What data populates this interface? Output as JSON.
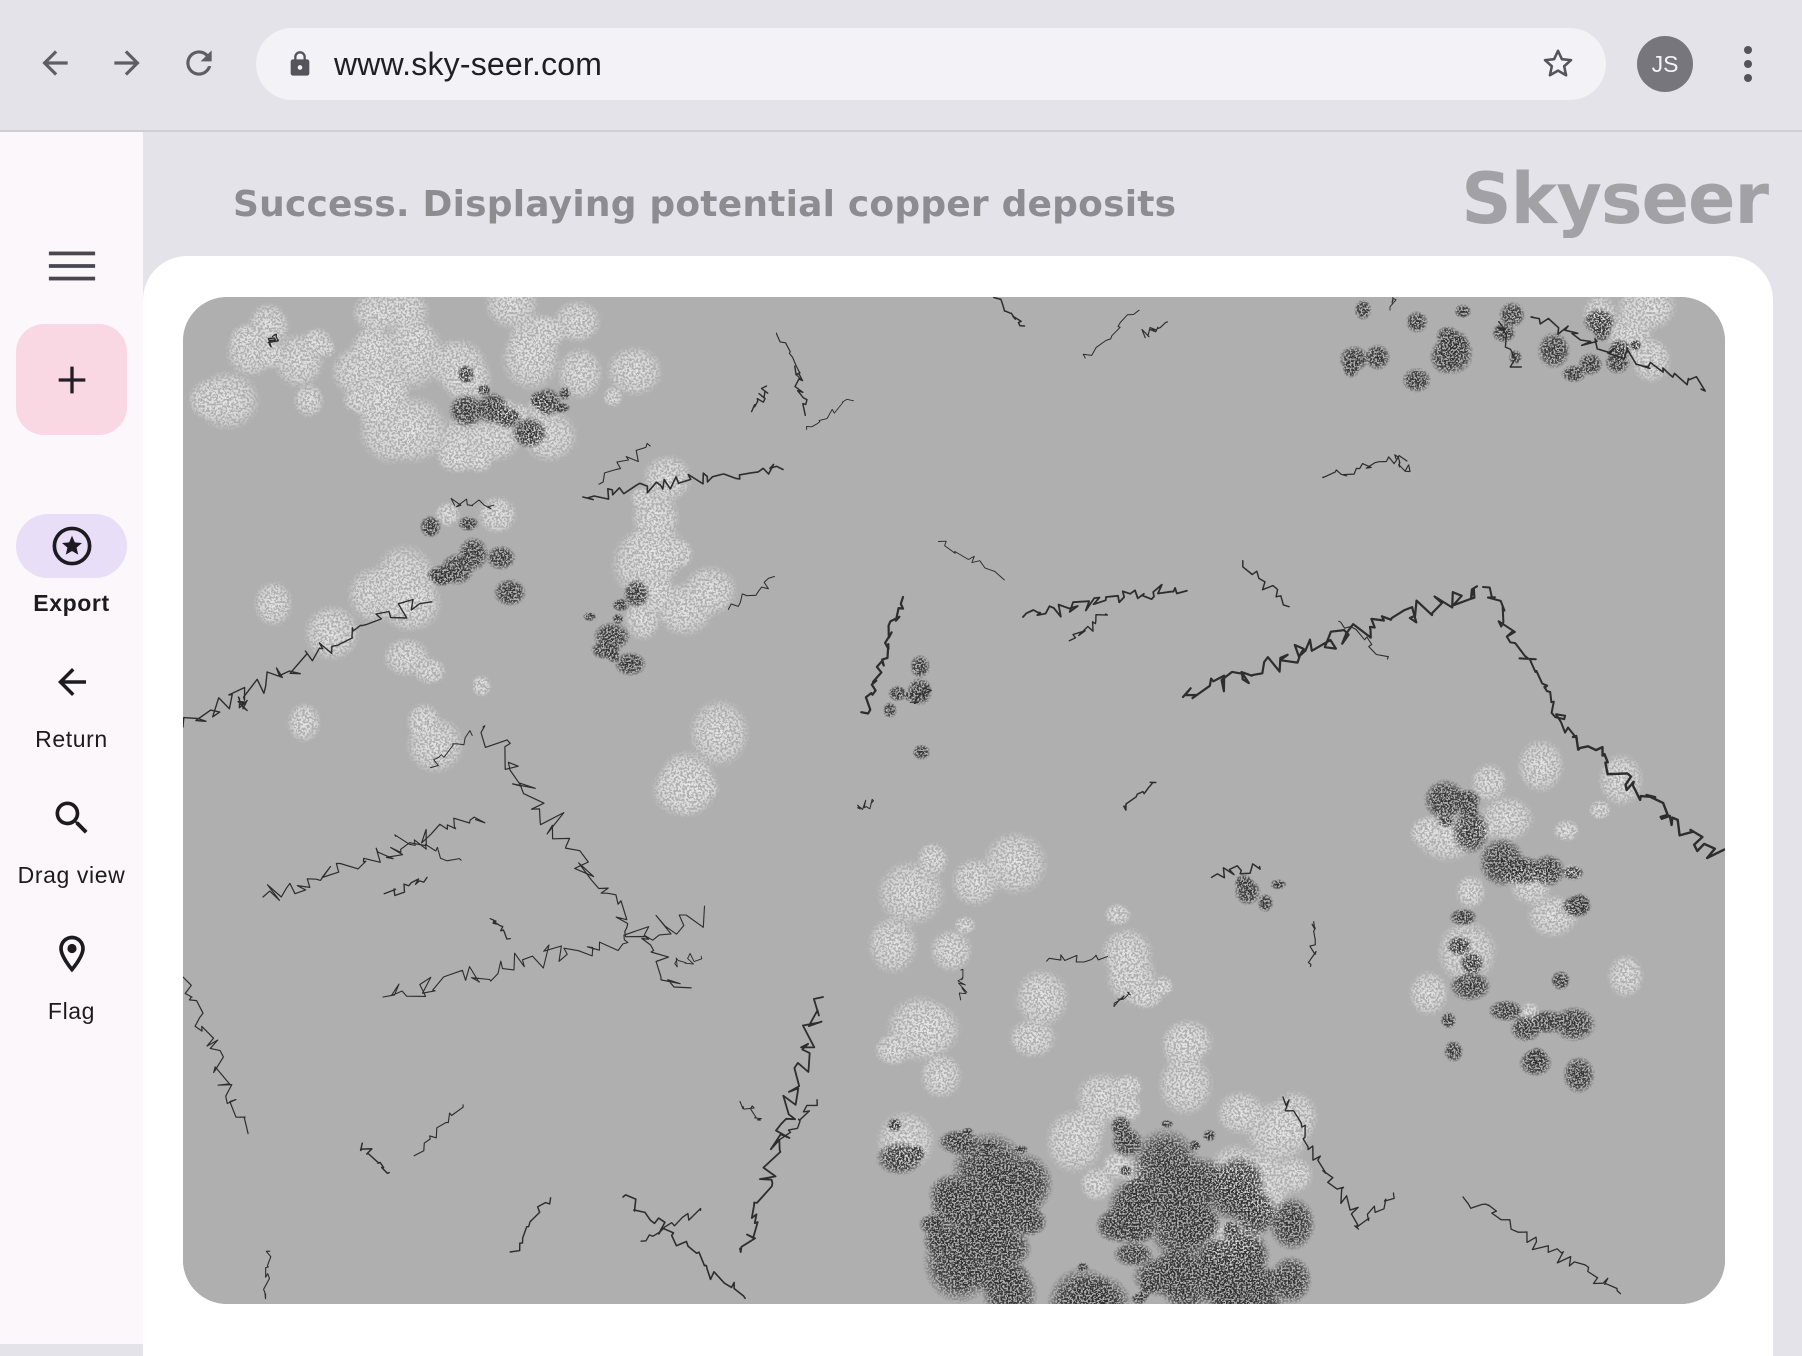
{
  "browser": {
    "url": "www.sky-seer.com",
    "profile_initials": "JS",
    "icons": {
      "back": "arrow-back-icon",
      "forward": "arrow-forward-icon",
      "reload": "reload-icon",
      "lock": "lock-icon",
      "bookmark": "star-outline-icon",
      "menu": "kebab-menu-icon"
    }
  },
  "rail": {
    "menu_icon": "hamburger-menu-icon",
    "fab_icon": "plus-icon",
    "items": [
      {
        "label": "Export",
        "icon": "star-circle-icon",
        "active": true
      },
      {
        "label": "Return",
        "icon": "arrow-back-icon",
        "active": false
      },
      {
        "label": "Drag view",
        "icon": "search-icon",
        "active": false
      },
      {
        "label": "Flag",
        "icon": "map-pin-icon",
        "active": false
      }
    ]
  },
  "main": {
    "status": "Success. Displaying potential copper deposits",
    "brand": "Skyseer"
  },
  "map": {
    "description_icon": "satellite-map-icon"
  },
  "colors": {
    "chrome_bg": "#e4e3e9",
    "omnibox_bg": "#f3f2f7",
    "rail_bg": "#fcf7fb",
    "fab_bg": "#fad8e3",
    "active_pill": "#e8def7",
    "map_base": "#afafaf",
    "map_dark": "#2f2f2f",
    "map_light": "#e2e2e2",
    "muted_text": "#8d8d91"
  }
}
